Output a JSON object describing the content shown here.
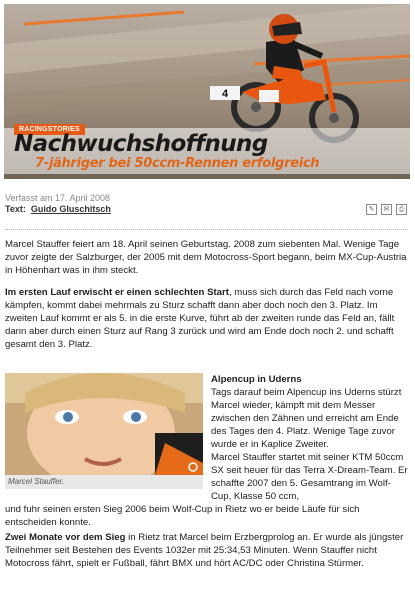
{
  "hero": {
    "tag": "RACINGSTORIES",
    "title": "Nachwuchshoffnung",
    "subtitle": "7-jähriger bei 50ccm-Rennen erfolgreich",
    "bike_number": "4"
  },
  "meta": {
    "date": "Verfasst am 17. April 2008",
    "author_label": "Text:",
    "author": "Guido Gluschitsch"
  },
  "tools": {
    "icons": [
      "edit-icon",
      "email-icon",
      "print-icon"
    ]
  },
  "article": {
    "p1": "Marcel Stauffer feiert am 18. April seinen Geburtstag. 2008 zum siebenten Mal. Wenige Tage zuvor zeigte der Salzburger, der 2005 mit dem Motocross-Sport begann, beim MX-Cup-Austria in Höhenhart was in ihm steckt.",
    "p2_lead": "Im ersten Lauf erwischt er einen schlechten Start",
    "p2_rest": ", muss sich durch das Feld nach vorne kämpfen, kommt dabei mehrmals zu Sturz schafft dann aber doch noch den 3. Platz. Im zweiten Lauf kommt er als 5. in die erste Kurve, führt ab der zweiten runde das Feld an, fällt dann aber durch einen Sturz auf Rang 3 zurück und wird am Ende doch noch 2. und schafft gesamt den 3. Platz.",
    "side_heading": "Alpencup in Uderns",
    "side_p1": "Tags darauf beim Alpencup ins Uderns stürzt Marcel wieder, kämpft mit dem Messer zwischen den Zähnen und erreicht am Ende des Tages den 4. Platz. Wenige Tage zuvor wurde er in Kaplice Zweiter.",
    "side_p2": "Marcel Stauffer startet mit seiner KTM 50ccm SX seit heuer für das Terra X-Dream-Team. Er schaffte 2007 den 5. Gesamtrang im Wolf-Cup, Klasse 50 ccm,",
    "p3": "und fuhr seinen ersten Sieg 2006 beim Wolf-Cup in Rietz wo er beide Läufe für sich entscheiden konnte.",
    "p4_lead": "Zwei Monate vor dem Sieg",
    "p4_rest": " in Rietz trat Marcel beim Erzbergprolog an. Er wurde als jüngster Teilnehmer seit Bestehen des Events 1032er mit 25:34,53 Minuten. Wenn Stauffer nicht Motocross fährt, spielt er Fußball, fährt BMX und hört AC/DC oder Christina Stürmer.",
    "photo_caption": "Marcel Stauffer."
  }
}
